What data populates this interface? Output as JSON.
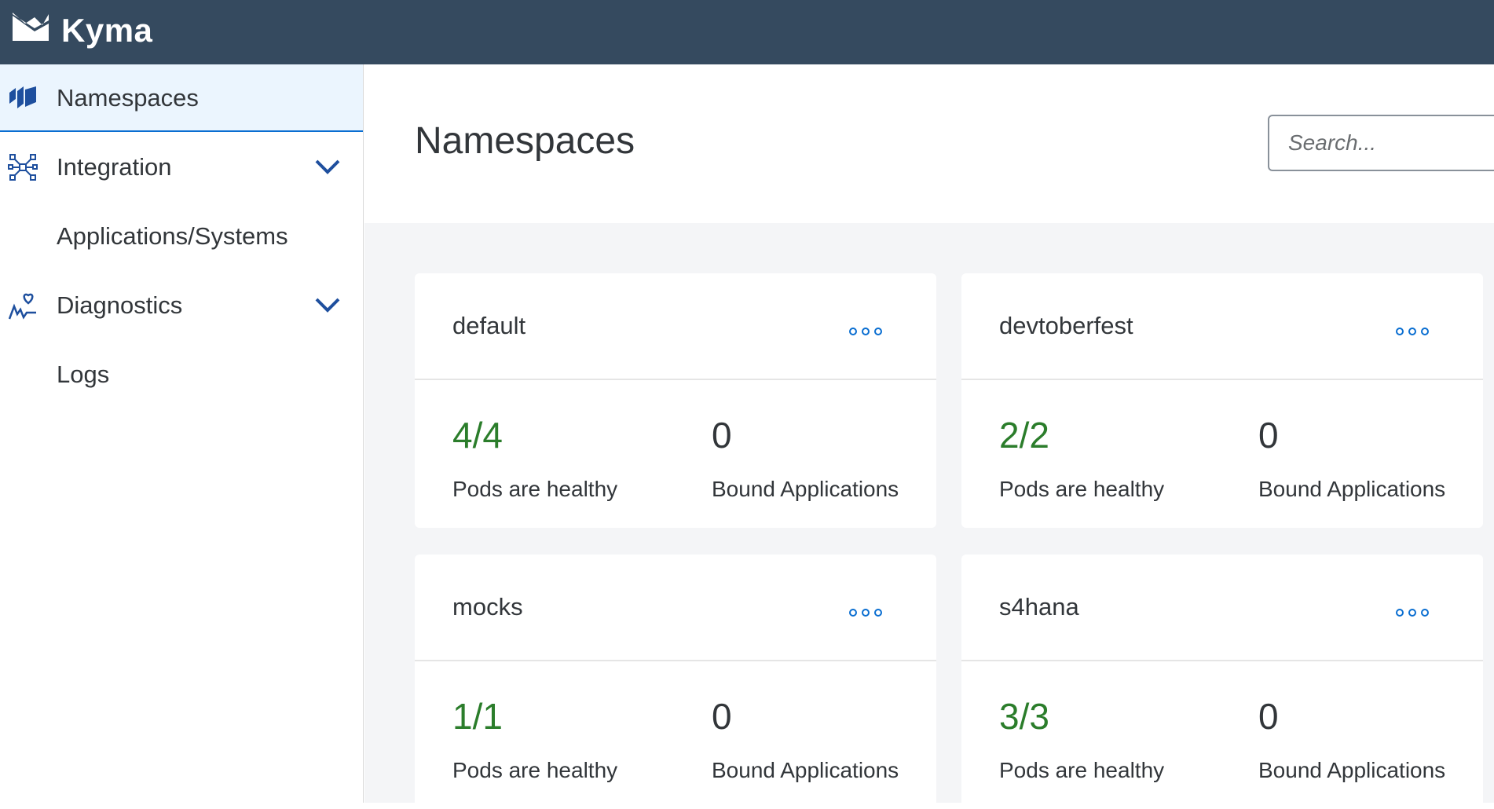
{
  "app": {
    "brand": "Kyma",
    "brand_icon": "kyma-logo-icon"
  },
  "sidebar": {
    "items": [
      {
        "label": "Namespaces",
        "icon": "namespaces-icon",
        "active": true
      },
      {
        "label": "Integration",
        "icon": "integration-icon",
        "expandable": true
      },
      {
        "label": "Applications/Systems",
        "sub": true
      },
      {
        "label": "Diagnostics",
        "icon": "diagnostics-icon",
        "expandable": true
      },
      {
        "label": "Logs",
        "sub": true
      }
    ]
  },
  "header": {
    "title": "Namespaces",
    "search_placeholder": "Search..."
  },
  "cards": [
    {
      "name": "default",
      "pods": "4/4",
      "pods_label": "Pods are healthy",
      "bound": "0",
      "bound_label": "Bound Applications"
    },
    {
      "name": "devtoberfest",
      "pods": "2/2",
      "pods_label": "Pods are healthy",
      "bound": "0",
      "bound_label": "Bound Applications"
    },
    {
      "name": "mocks",
      "pods": "1/1",
      "pods_label": "Pods are healthy",
      "bound": "0",
      "bound_label": "Bound Applications"
    },
    {
      "name": "s4hana",
      "pods": "3/3",
      "pods_label": "Pods are healthy",
      "bound": "0",
      "bound_label": "Bound Applications"
    }
  ],
  "colors": {
    "header_bg": "#354a5f",
    "accent": "#0a6ed1",
    "healthy": "#2b7d2b"
  }
}
